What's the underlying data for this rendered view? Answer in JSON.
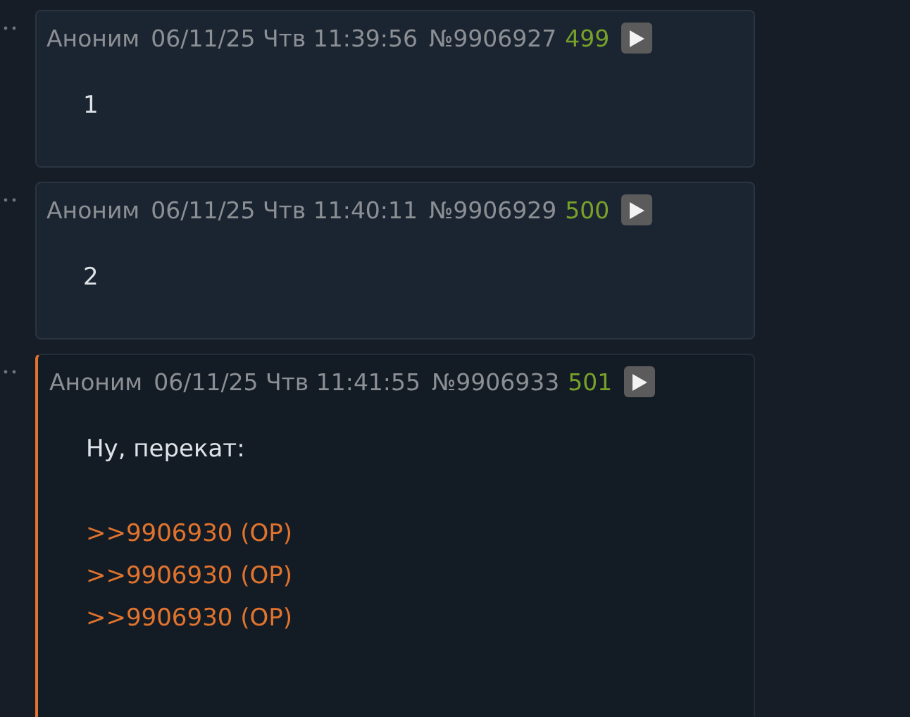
{
  "posts": [
    {
      "author": "Аноним",
      "datetime": "06/11/25 Чтв 11:39:56",
      "number": "№9906927",
      "ordinal": "499",
      "highlighted": false,
      "paragraphs": [
        {
          "lines": [
            {
              "kind": "text",
              "text": "1"
            }
          ]
        }
      ]
    },
    {
      "author": "Аноним",
      "datetime": "06/11/25 Чтв 11:40:11",
      "number": "№9906929",
      "ordinal": "500",
      "highlighted": false,
      "paragraphs": [
        {
          "lines": [
            {
              "kind": "text",
              "text": "2"
            }
          ]
        }
      ]
    },
    {
      "author": "Аноним",
      "datetime": "06/11/25 Чтв 11:41:55",
      "number": "№9906933",
      "ordinal": "501",
      "highlighted": true,
      "paragraphs": [
        {
          "lines": [
            {
              "kind": "text",
              "text": "Ну, перекат:"
            }
          ]
        },
        {
          "lines": [
            {
              "kind": "link",
              "text": ">>9906930 (OP)"
            },
            {
              "kind": "link",
              "text": ">>9906930 (OP)"
            },
            {
              "kind": "link",
              "text": ">>9906930 (OP)"
            }
          ]
        }
      ]
    }
  ]
}
